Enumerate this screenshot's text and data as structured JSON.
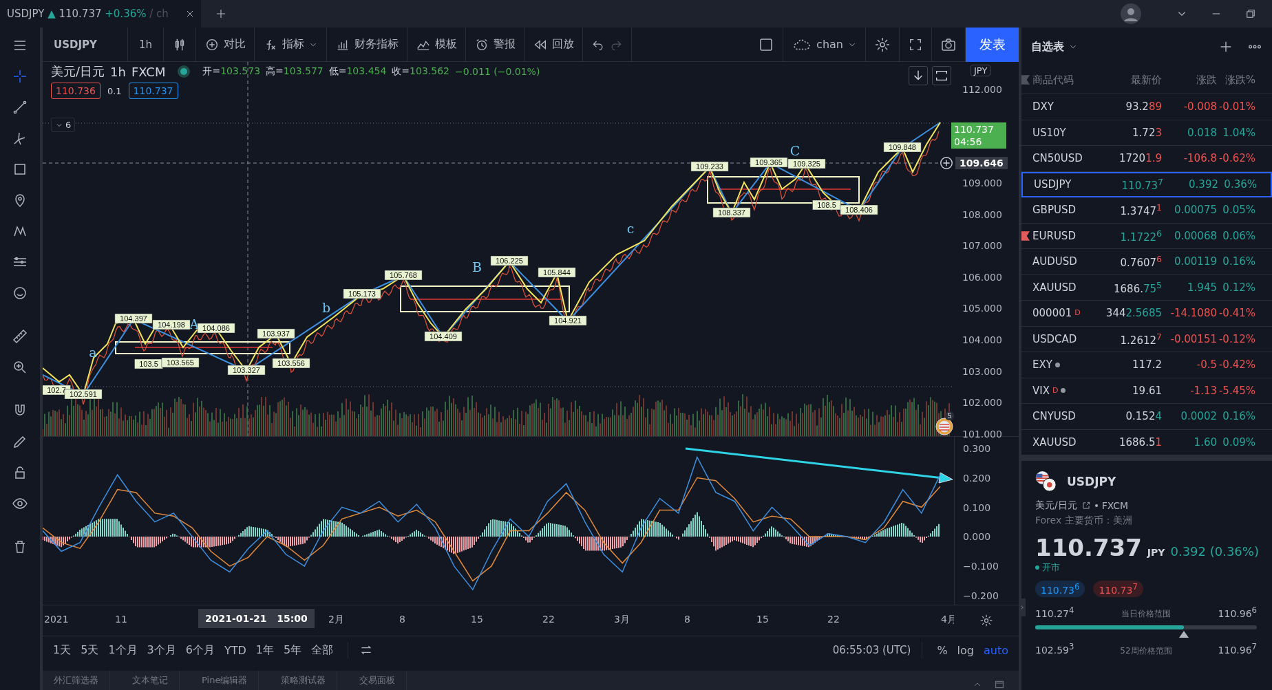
{
  "tab": {
    "symbol": "USDJPY",
    "arrow": "▲",
    "price": "110.737",
    "change": "+0.36%",
    "rest": "/ ch"
  },
  "toolbar": {
    "symbol": "USDJPY",
    "interval": "1h",
    "items": [
      {
        "kind": "compare",
        "label": "对比"
      },
      {
        "kind": "indicator",
        "label": "指标"
      },
      {
        "kind": "financials",
        "label": "财务指标"
      },
      {
        "kind": "template",
        "label": "模板"
      },
      {
        "kind": "alert",
        "label": "警报"
      },
      {
        "kind": "replay",
        "label": "回放"
      }
    ],
    "layout": "chan",
    "publish": "发表"
  },
  "legend": {
    "title": "美元/日元",
    "interval": "1h",
    "source": "FXCM",
    "ohlc": [
      {
        "label": "开=",
        "value": "103.573"
      },
      {
        "label": "高=",
        "value": "103.577"
      },
      {
        "label": "低=",
        "value": "103.454"
      },
      {
        "label": "收=",
        "value": "103.562"
      }
    ],
    "change": "−0.011 (−0.01%)",
    "bid": "110.736",
    "spread": "0.1",
    "ask": "110.737",
    "indicators_count": "6"
  },
  "price_axis": {
    "currency": "JPY",
    "ticks": [
      "112.000",
      "109.000",
      "108.000",
      "107.000",
      "106.000",
      "105.000",
      "104.000",
      "103.000",
      "102.000",
      "101.000"
    ],
    "last_price": "110.737",
    "countdown": "04:56",
    "crosshair_price": "109.646"
  },
  "wave_labels": [
    "a",
    "A",
    "b",
    "B",
    "c",
    "C"
  ],
  "pivot_labels": [
    "102.7",
    "102.591",
    "104.397",
    "104.198",
    "104.086",
    "103.937",
    "103.5",
    "103.565",
    "103.327",
    "103.556",
    "105.173",
    "105.768",
    "104.409",
    "106.225",
    "105.844",
    "104.921",
    "109.233",
    "109.365",
    "109.325",
    "108.337",
    "108.5",
    "108.406",
    "109.848"
  ],
  "event_badge": "5",
  "oscillator": {
    "chart_data": {
      "type": "line",
      "ylim": [
        -0.231,
        0.339
      ],
      "yticks": [
        {
          "value": 0.3,
          "label": "0.300"
        },
        {
          "value": 0.2,
          "label": "0.200"
        },
        {
          "value": 0.1,
          "label": "0.100"
        },
        {
          "value": 0,
          "label": "0.000"
        },
        {
          "value": -0.1,
          "label": "−0.100"
        },
        {
          "value": -0.2,
          "label": "−0.200"
        }
      ],
      "series": [
        {
          "color": "#3d8fe0",
          "values": [
            0.02,
            -0.05,
            -0.02,
            0.1,
            0.21,
            0.12,
            0.05,
            0.08,
            0.0,
            -0.08,
            -0.12,
            -0.04,
            0.02,
            -0.06,
            -0.1,
            0.02,
            0.1,
            0.08,
            0.12,
            0.05,
            0.11,
            0.03,
            -0.1,
            -0.18,
            -0.05,
            0.06,
            0.0,
            0.12,
            0.18,
            0.05,
            -0.06,
            -0.12,
            0.03,
            0.13,
            0.08,
            0.27,
            0.15,
            0.12,
            0.02,
            0.1,
            0.04,
            -0.03,
            0.01,
            0.0,
            -0.02,
            0.05,
            0.16,
            0.08,
            0.21
          ]
        },
        {
          "color": "#e08a3c",
          "values": [
            0.03,
            -0.02,
            -0.04,
            0.05,
            0.16,
            0.15,
            0.08,
            0.07,
            0.03,
            -0.05,
            -0.1,
            -0.07,
            0.0,
            -0.03,
            -0.08,
            -0.03,
            0.06,
            0.08,
            0.1,
            0.07,
            0.09,
            0.05,
            -0.05,
            -0.15,
            -0.1,
            0.02,
            0.02,
            0.08,
            0.15,
            0.09,
            -0.02,
            -0.09,
            -0.02,
            0.09,
            0.09,
            0.2,
            0.19,
            0.13,
            0.05,
            0.07,
            0.06,
            0.0,
            0.0,
            0.0,
            -0.01,
            0.03,
            0.12,
            0.1,
            0.17
          ]
        }
      ]
    }
  },
  "time_axis": {
    "labels": [
      "2021",
      "11",
      "2月",
      "8",
      "15",
      "22",
      "3月",
      "8",
      "15",
      "22",
      "4月"
    ],
    "crosshair_date": "2021-01-21",
    "crosshair_time": "15:00"
  },
  "ranges": [
    "1天",
    "5天",
    "1个月",
    "3个月",
    "6个月",
    "YTD",
    "1年",
    "5年",
    "全部"
  ],
  "clock": "06:55:03 (UTC)",
  "scale_options": [
    {
      "label": "%",
      "selected": false
    },
    {
      "label": "log",
      "selected": false
    },
    {
      "label": "auto",
      "selected": true
    }
  ],
  "bottom_tabs": [
    "外汇筛选器",
    "文本笔记",
    "Pine编辑器",
    "策略测试器",
    "交易面板"
  ],
  "watchlist": {
    "title": "自选表",
    "columns": [
      "商品代码",
      "最新价",
      "涨跌",
      "涨跌%"
    ],
    "rows": [
      {
        "symbol": "DXY",
        "price": "93.2",
        "tail": "89",
        "tail_rising": false,
        "change": "-0.008",
        "pct": "-0.01%",
        "selected": false,
        "flagged": false,
        "closed": false
      },
      {
        "symbol": "US10Y",
        "price": "1.72",
        "tail": "3",
        "tail_rising": false,
        "change": "0.018",
        "pct": "1.04%",
        "selected": false,
        "flagged": false,
        "closed": false
      },
      {
        "symbol": "CN50USD",
        "price": "1720",
        "tail": "1.9",
        "tail_rising": false,
        "change": "-106.8",
        "pct": "-0.62%",
        "selected": false,
        "flagged": false,
        "closed": false
      },
      {
        "symbol": "USDJPY",
        "price": "",
        "tail": "110.73$^{7}$",
        "tail_rising": true,
        "change": "0.392",
        "pct": "0.36%",
        "selected": true,
        "flagged": false,
        "closed": false
      },
      {
        "symbol": "GBPUSD",
        "price": "1.3747",
        "tail": "$^{1}$",
        "tail_rising": false,
        "change": "0.00075",
        "pct": "0.05%",
        "selected": false,
        "flagged": false,
        "closed": false
      },
      {
        "symbol": "EURUSD",
        "price": "",
        "tail": "1.1722$^{6}$",
        "tail_rising": true,
        "change": "0.00068",
        "pct": "0.06%",
        "selected": false,
        "flagged": true,
        "closed": false
      },
      {
        "symbol": "AUDUSD",
        "price": "0.7607",
        "tail": "$^{6}$",
        "tail_rising": false,
        "change": "0.00119",
        "pct": "0.16%",
        "selected": false,
        "flagged": false,
        "closed": false
      },
      {
        "symbol": "XAUUSD",
        "price": "1686.",
        "tail": "75$^{5}$",
        "tail_rising": true,
        "change": "1.945",
        "pct": "0.12%",
        "selected": false,
        "flagged": false,
        "closed": false
      },
      {
        "symbol": "000001",
        "badge": "D",
        "price": "344",
        "tail": "2.5685",
        "tail_rising": true,
        "change": "-14.1080",
        "pct": "-0.41%",
        "selected": false,
        "flagged": false,
        "closed": false
      },
      {
        "symbol": "USDCAD",
        "price": "1.2612",
        "tail": "$^{7}$",
        "tail_rising": false,
        "change": "-0.00151",
        "pct": "-0.12%",
        "selected": false,
        "flagged": false,
        "closed": false
      },
      {
        "symbol": "EXY",
        "price": "117.2",
        "change": "-0.5",
        "pct": "-0.42%",
        "selected": false,
        "flagged": false,
        "closed": true
      },
      {
        "symbol": "VIX",
        "badge": "D",
        "price": "19.61",
        "change": "-1.13",
        "pct": "-5.45%",
        "selected": false,
        "flagged": false,
        "closed": true
      },
      {
        "symbol": "CNYUSD",
        "price": "0.152",
        "tail": "4",
        "tail_rising": true,
        "change": "0.0002",
        "pct": "0.16%",
        "selected": false,
        "flagged": false,
        "closed": false
      },
      {
        "symbol": "XAUUSD",
        "price": "1686.5",
        "tail": "1",
        "tail_rising": false,
        "change": "1.60",
        "pct": "0.09%",
        "selected": false,
        "flagged": false,
        "closed": false
      }
    ]
  },
  "details": {
    "symbol": "USDJPY",
    "description": "美元/日元",
    "exchange": "FXCM",
    "category": "Forex 主要货币：美洲",
    "price": "110.737",
    "currency": "JPY",
    "change": "0.392 (0.36%)",
    "status": "开市",
    "bid": "110.73$^{6}$",
    "ask": "110.73$^{7}$",
    "day_range": {
      "low": "110.27$^{4}$",
      "label": "当日价格范围",
      "high": "110.96$^{6}$",
      "level": 0.67
    },
    "year_range": {
      "low": "102.59$^{3}$",
      "label": "52周价格范围",
      "high": "110.96$^{7}$"
    }
  }
}
